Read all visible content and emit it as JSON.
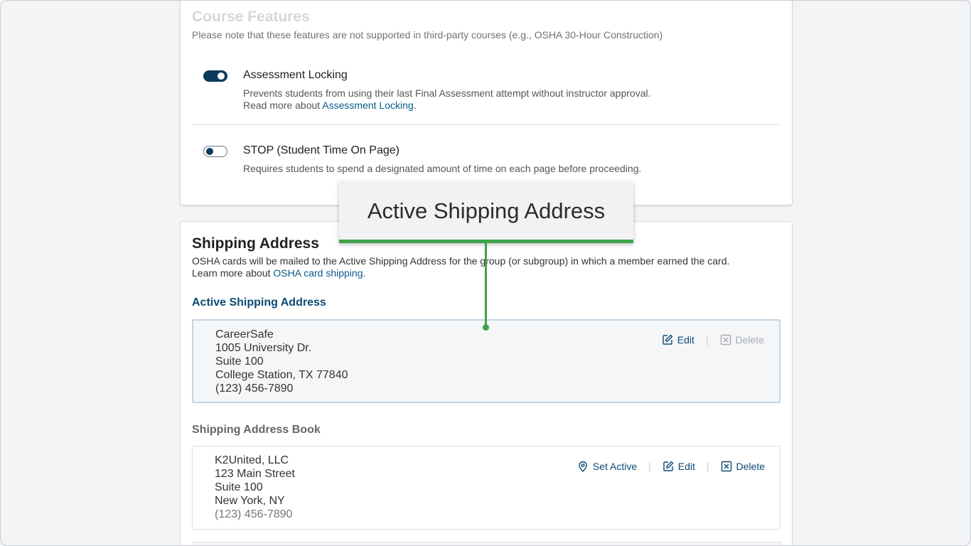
{
  "course_features": {
    "title": "Course Features",
    "subtitle": "Please note that these features are not supported in third-party courses (e.g., OSHA 30-Hour Construction)",
    "features": [
      {
        "name": "Assessment Locking",
        "enabled": true,
        "description": "Prevents students from using their last Final Assessment attempt without instructor approval.",
        "read_more_prefix": "Read more about ",
        "read_more_link": "Assessment Locking",
        "read_more_suffix": "."
      },
      {
        "name": "STOP (Student Time On Page)",
        "enabled": false,
        "description": "Requires students to spend a designated amount of time on each page before proceeding."
      }
    ]
  },
  "shipping": {
    "title": "Shipping Address",
    "description": "OSHA cards will be mailed to the Active Shipping Address for the group (or subgroup) in which a member earned the card.",
    "learn_more_prefix": "Learn more about ",
    "learn_more_link": "OSHA card shipping",
    "learn_more_suffix": ".",
    "active_heading": "Active Shipping Address",
    "active_address": {
      "name": "CareerSafe",
      "street": "1005 University Dr.",
      "suite": "Suite 100",
      "city": "College Station, TX 77840",
      "phone": "(123) 456-7890"
    },
    "book_heading": "Shipping Address Book",
    "book_addresses": [
      {
        "name": "K2United, LLC",
        "street": "123 Main Street",
        "suite": "Suite 100",
        "city": "New York, NY",
        "phone": "(123) 456-7890"
      }
    ],
    "actions": {
      "set_active": "Set Active",
      "edit": "Edit",
      "delete": "Delete",
      "separator": "|"
    }
  },
  "callout": {
    "text": "Active Shipping Address",
    "color": "#3fa24a"
  },
  "colors": {
    "primary": "#0b3a5b",
    "link": "#0b5a8a",
    "accent_green": "#3fa24a"
  }
}
